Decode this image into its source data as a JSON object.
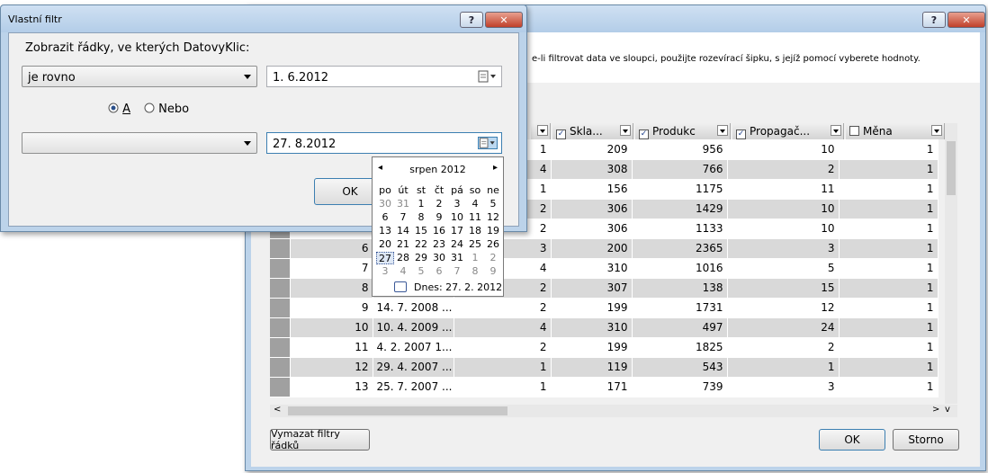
{
  "back_window": {
    "title_help": "?",
    "close": "✕",
    "info": "e-li filtrovat data ve sloupci, použijte rozevírací šipku, s jejíž pomocí vyberete hodnoty.",
    "columns": [
      {
        "label": "Skla...",
        "checked": true
      },
      {
        "label": "Produkc",
        "checked": true
      },
      {
        "label": "Propagač...",
        "checked": true
      },
      {
        "label": "Měna",
        "checked": false
      }
    ],
    "rows": [
      {
        "idx": "",
        "date": "",
        "a": "1",
        "b": "209",
        "c": "956",
        "d": "10",
        "e": "1"
      },
      {
        "idx": "",
        "date": "",
        "a": "4",
        "b": "308",
        "c": "766",
        "d": "2",
        "e": "1"
      },
      {
        "idx": "",
        "date": "",
        "a": "1",
        "b": "156",
        "c": "1175",
        "d": "11",
        "e": "1"
      },
      {
        "idx": "",
        "date": "",
        "a": "2",
        "b": "306",
        "c": "1429",
        "d": "10",
        "e": "1"
      },
      {
        "idx": "",
        "date": "",
        "a": "2",
        "b": "306",
        "c": "1133",
        "d": "10",
        "e": "1"
      },
      {
        "idx": "6",
        "date": "",
        "a": "3",
        "b": "200",
        "c": "2365",
        "d": "3",
        "e": "1"
      },
      {
        "idx": "7",
        "date": "",
        "a": "4",
        "b": "310",
        "c": "1016",
        "d": "5",
        "e": "1"
      },
      {
        "idx": "8",
        "date": "",
        "a": "2",
        "b": "307",
        "c": "138",
        "d": "15",
        "e": "1"
      },
      {
        "idx": "9",
        "date": "14. 7. 2008 ...",
        "a": "2",
        "b": "199",
        "c": "1731",
        "d": "12",
        "e": "1"
      },
      {
        "idx": "10",
        "date": "10. 4. 2009 ...",
        "a": "4",
        "b": "310",
        "c": "497",
        "d": "24",
        "e": "1"
      },
      {
        "idx": "11",
        "date": "4. 2. 2007 1...",
        "a": "2",
        "b": "199",
        "c": "1825",
        "d": "2",
        "e": "1"
      },
      {
        "idx": "12",
        "date": "29. 4. 2007 ...",
        "a": "1",
        "b": "119",
        "c": "543",
        "d": "1",
        "e": "1"
      },
      {
        "idx": "13",
        "date": "25. 7. 2007 ...",
        "a": "1",
        "b": "171",
        "c": "739",
        "d": "3",
        "e": "1"
      }
    ],
    "clear_filters": "Vymazat filtry řádků",
    "ok": "OK",
    "cancel": "Storno"
  },
  "filter_dialog": {
    "title": "Vlastní filtr",
    "help": "?",
    "close": "✕",
    "prompt": "Zobrazit řádky, ve kterých DatovyKlic:",
    "operator1": "je rovno",
    "value1": "1.  6.2012",
    "radio_and": "A",
    "radio_or": "Nebo",
    "operator2": "",
    "value2": "27.  8.2012",
    "ok": "OK"
  },
  "calendar": {
    "month": "srpen 2012",
    "prev": "◂",
    "next": "▸",
    "weekdays": [
      "po",
      "út",
      "st",
      "čt",
      "pá",
      "so",
      "ne"
    ],
    "days": [
      "30",
      "31",
      "1",
      "2",
      "3",
      "4",
      "5",
      "6",
      "7",
      "8",
      "9",
      "10",
      "11",
      "12",
      "13",
      "14",
      "15",
      "16",
      "17",
      "18",
      "19",
      "20",
      "21",
      "22",
      "23",
      "24",
      "25",
      "26",
      "27",
      "28",
      "29",
      "30",
      "31",
      "1",
      "2",
      "3",
      "4",
      "5",
      "6",
      "7",
      "8",
      "9"
    ],
    "today": "Dnes: 27. 2. 2012"
  }
}
